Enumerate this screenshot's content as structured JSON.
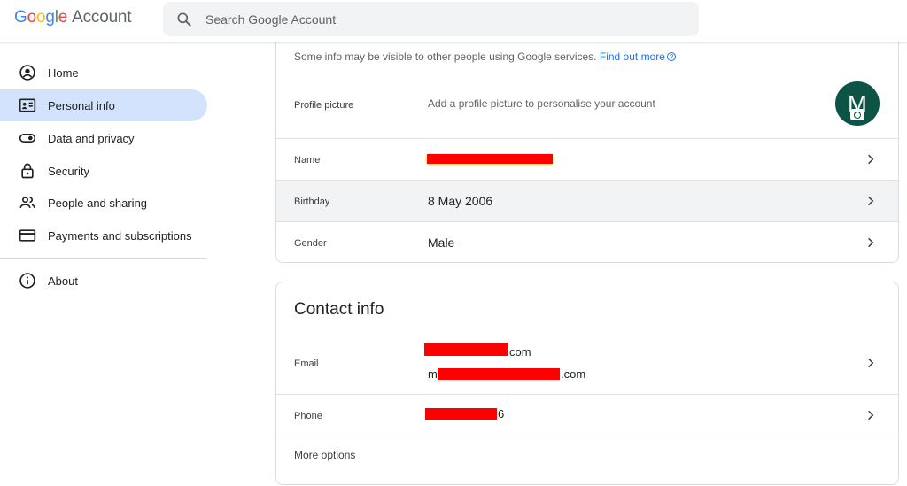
{
  "header": {
    "logo_letters": [
      "G",
      "o",
      "o",
      "g",
      "l",
      "e"
    ],
    "logo_suffix": "Account",
    "search_placeholder": "Search Google Account"
  },
  "sidebar": {
    "items": [
      {
        "label": "Home",
        "icon": "account-circle-icon",
        "active": false
      },
      {
        "label": "Personal info",
        "icon": "id-card-icon",
        "active": true
      },
      {
        "label": "Data and privacy",
        "icon": "toggle-icon",
        "active": false
      },
      {
        "label": "Security",
        "icon": "lock-icon",
        "active": false
      },
      {
        "label": "People and sharing",
        "icon": "people-icon",
        "active": false
      },
      {
        "label": "Payments and subscriptions",
        "icon": "credit-card-icon",
        "active": false
      },
      {
        "label": "About",
        "icon": "info-icon",
        "active": false
      }
    ]
  },
  "basic_info": {
    "notice": "Some info may be visible to other people using Google services.",
    "notice_link": "Find out more",
    "profile_picture": {
      "label": "Profile picture",
      "value": "Add a profile picture to personalise your account",
      "avatar_letter": "M",
      "avatar_color": "#0d5346"
    },
    "name": {
      "label": "Name"
    },
    "birthday": {
      "label": "Birthday",
      "value": "8 May 2006"
    },
    "gender": {
      "label": "Gender",
      "value": "Male"
    }
  },
  "contact_info": {
    "title": "Contact info",
    "email": {
      "label": "Email",
      "line1_suffix": "com",
      "line2_prefix": "m",
      "line2_suffix": ".com"
    },
    "phone": {
      "label": "Phone",
      "suffix": "6"
    },
    "more_options": "More options"
  },
  "colors": {
    "accent": "#1a73e8",
    "active_nav": "#d3e3fd",
    "redaction": "#ff0000"
  }
}
